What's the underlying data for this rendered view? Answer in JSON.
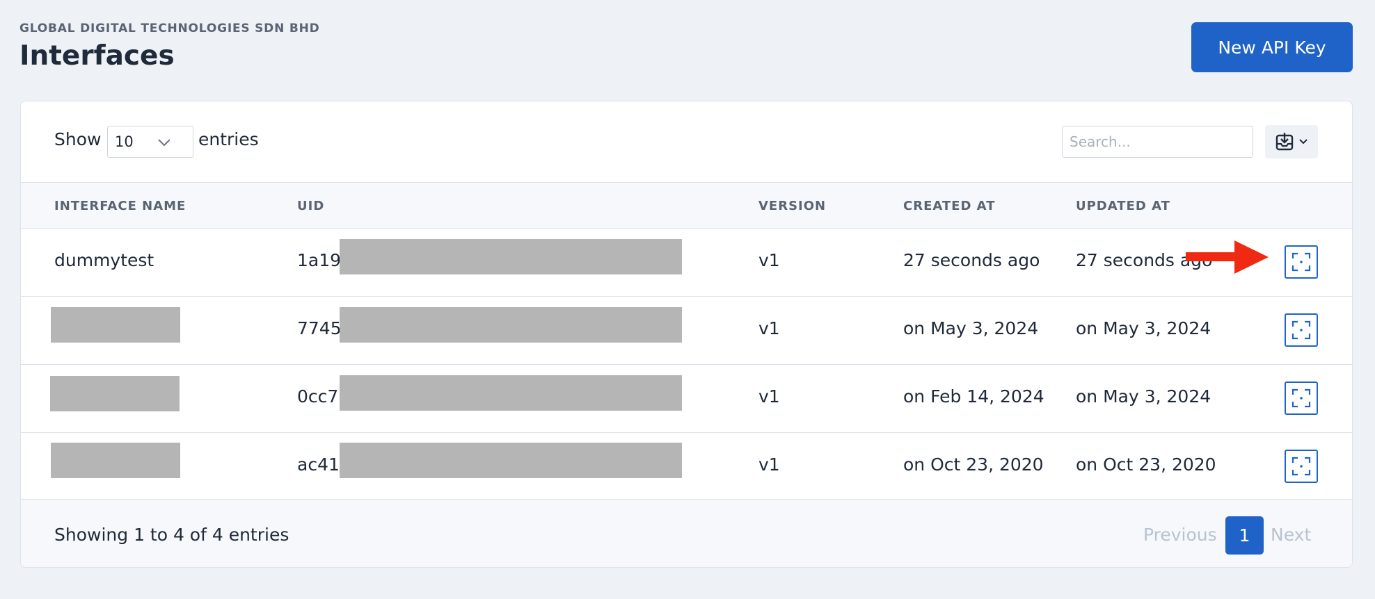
{
  "header": {
    "organization": "GLOBAL DIGITAL TECHNOLOGIES SDN BHD",
    "title": "Interfaces",
    "new_button": "New API Key"
  },
  "toolbar": {
    "show_label": "Show",
    "page_size": "10",
    "entries_label": "entries",
    "search_placeholder": "Search...",
    "export_icon": "download-tray-icon"
  },
  "table": {
    "columns": [
      "INTERFACE NAME",
      "UID",
      "VERSION",
      "CREATED AT",
      "UPDATED AT"
    ],
    "rows": [
      {
        "name": "dummytest",
        "uid": "1a19",
        "version": "v1",
        "created": "27 seconds ago",
        "updated": "27 seconds ago"
      },
      {
        "name": "",
        "uid": "7745",
        "version": "v1",
        "created": "on May 3, 2024",
        "updated": "on May 3, 2024"
      },
      {
        "name": "",
        "uid": "0cc7l",
        "version": "v1",
        "created": "on Feb 14, 2024",
        "updated": "on May 3, 2024"
      },
      {
        "name": "",
        "uid": "ac41",
        "version": "v1",
        "created": "on Oct 23, 2020",
        "updated": "on Oct 23, 2020"
      }
    ]
  },
  "footer": {
    "info": "Showing 1 to 4 of 4 entries",
    "previous": "Previous",
    "page": "1",
    "next": "Next"
  },
  "colors": {
    "accent": "#1f63c8",
    "annotation_arrow": "#f02a12"
  }
}
